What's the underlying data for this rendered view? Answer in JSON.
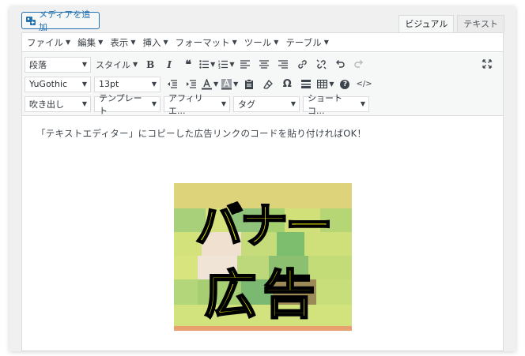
{
  "media_button": {
    "label": "メディアを追加",
    "icon": "media-add-icon"
  },
  "mode_tabs": [
    {
      "label": "ビジュアル",
      "active": true
    },
    {
      "label": "テキスト",
      "active": false
    }
  ],
  "menubar": [
    {
      "label": "ファイル"
    },
    {
      "label": "編集"
    },
    {
      "label": "表示"
    },
    {
      "label": "挿入"
    },
    {
      "label": "フォーマット"
    },
    {
      "label": "ツール"
    },
    {
      "label": "テーブル"
    }
  ],
  "toolbar": {
    "paragraph_select": "段落",
    "style_label": "スタイル",
    "font_select": "YuGothic",
    "size_select": "13pt",
    "row3": {
      "balloon": "吹き出し",
      "template": "テンプレート",
      "affiliate": "アフィリエ...",
      "tag": "タグ",
      "shortcode": "ショートコ..."
    },
    "icons": {
      "bold": "B",
      "italic": "I",
      "blockquote": "❝",
      "omega": "Ω",
      "help": "?",
      "code": "</>"
    }
  },
  "content": {
    "text": "「テキストエディター」にコピーした広告リンクのコードを貼り付ければOK！"
  },
  "banner": {
    "line1": "バナー",
    "line2": "広告",
    "text_color": "#ffff00",
    "outline_color": "#000000"
  }
}
